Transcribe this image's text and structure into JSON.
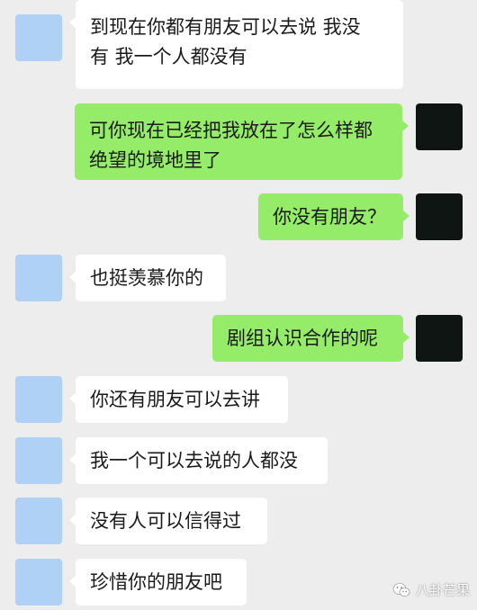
{
  "colors": {
    "background": "#ededed",
    "incoming_bubble": "#ffffff",
    "outgoing_bubble": "#95ec69",
    "incoming_avatar": "#aed1f5",
    "outgoing_avatar": "#0f1513"
  },
  "messages": [
    {
      "side": "left",
      "lines": [
        "到现在你都有朋友可以去说 我没",
        "有 我一个人都没有"
      ]
    },
    {
      "side": "right",
      "lines": [
        "可你现在已经把我放在了怎么样都",
        "绝望的境地里了"
      ]
    },
    {
      "side": "right",
      "lines": [
        "你没有朋友？"
      ]
    },
    {
      "side": "left",
      "lines": [
        "也挺羡慕你的"
      ]
    },
    {
      "side": "right",
      "lines": [
        "剧组认识合作的呢"
      ]
    },
    {
      "side": "left",
      "lines": [
        "你还有朋友可以去讲"
      ]
    },
    {
      "side": "left",
      "lines": [
        "我一个可以去说的人都没"
      ]
    },
    {
      "side": "left",
      "lines": [
        "没有人可以信得过"
      ]
    },
    {
      "side": "left",
      "lines": [
        "珍惜你的朋友吧"
      ]
    }
  ],
  "watermark": {
    "icon": "wechat-icon",
    "text": "八卦芒果"
  }
}
